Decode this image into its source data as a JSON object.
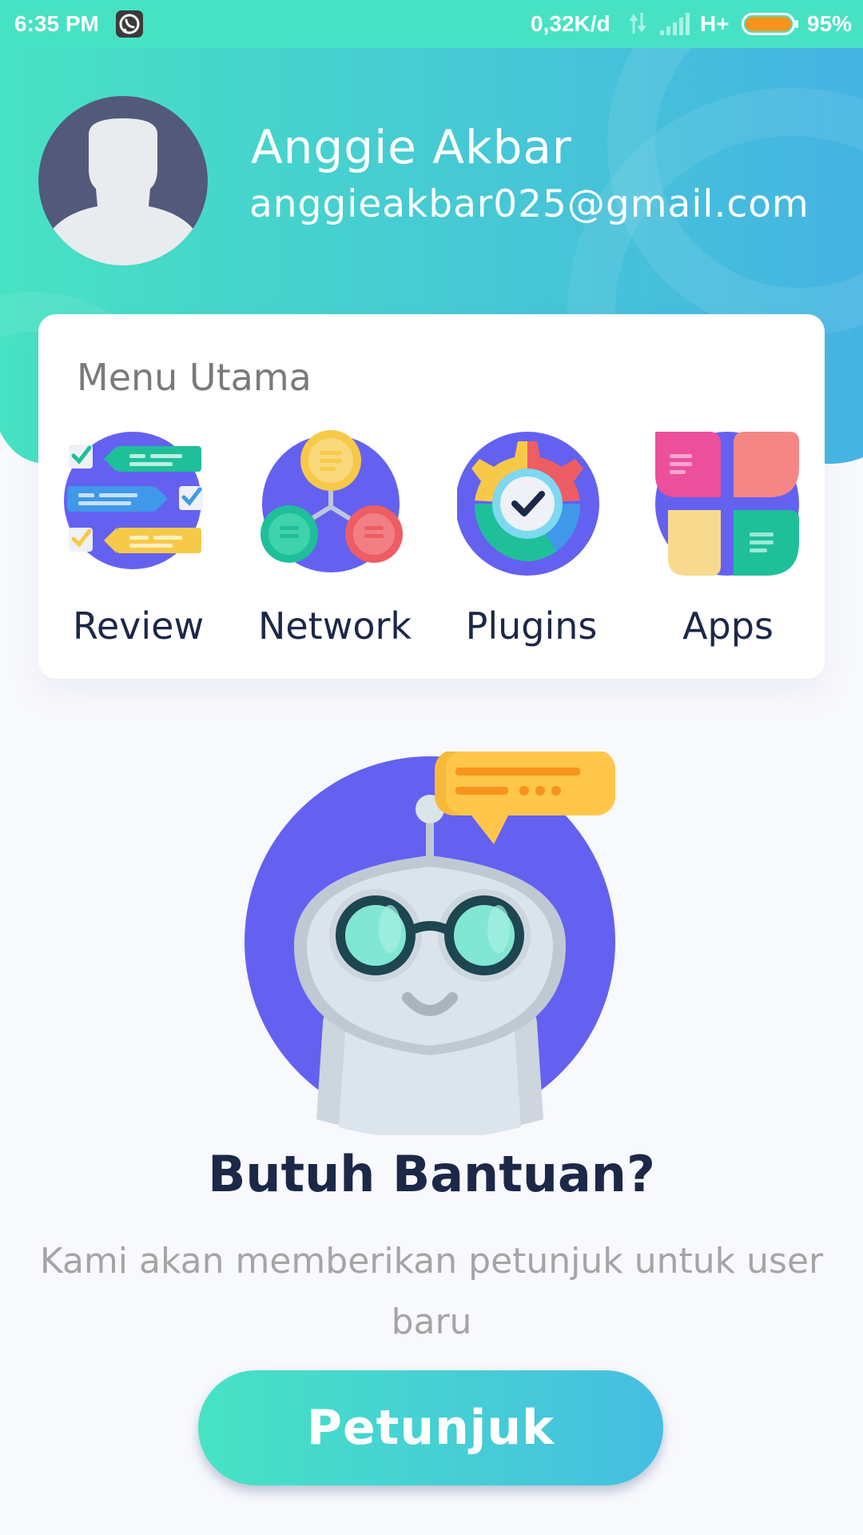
{
  "status_bar": {
    "time": "6:35 PM",
    "network_speed": "0,32K/d",
    "network_type": "H+",
    "battery_percent": "95%",
    "battery_level": 0.95,
    "notification_icon": "whatsapp-icon"
  },
  "profile": {
    "name": "Anggie Akbar",
    "email": "anggieakbar025@gmail.com"
  },
  "menu": {
    "title": "Menu Utama",
    "items": [
      {
        "label": "Review",
        "icon": "review-icon"
      },
      {
        "label": "Network",
        "icon": "network-icon"
      },
      {
        "label": "Plugins",
        "icon": "plugins-icon"
      },
      {
        "label": "Apps",
        "icon": "apps-icon"
      }
    ]
  },
  "help": {
    "title": "Butuh Bantuan?",
    "description": "Kami akan memberikan petunjuk untuk user baru",
    "button_label": "Petunjuk"
  },
  "colors": {
    "header_gradient_start": "#47e2c3",
    "header_gradient_end": "#45b4e3",
    "primary_text": "#1c2848",
    "secondary_text": "#a5a5a5",
    "accent_purple": "#6461f1",
    "page_background": "#f8f9fd"
  }
}
